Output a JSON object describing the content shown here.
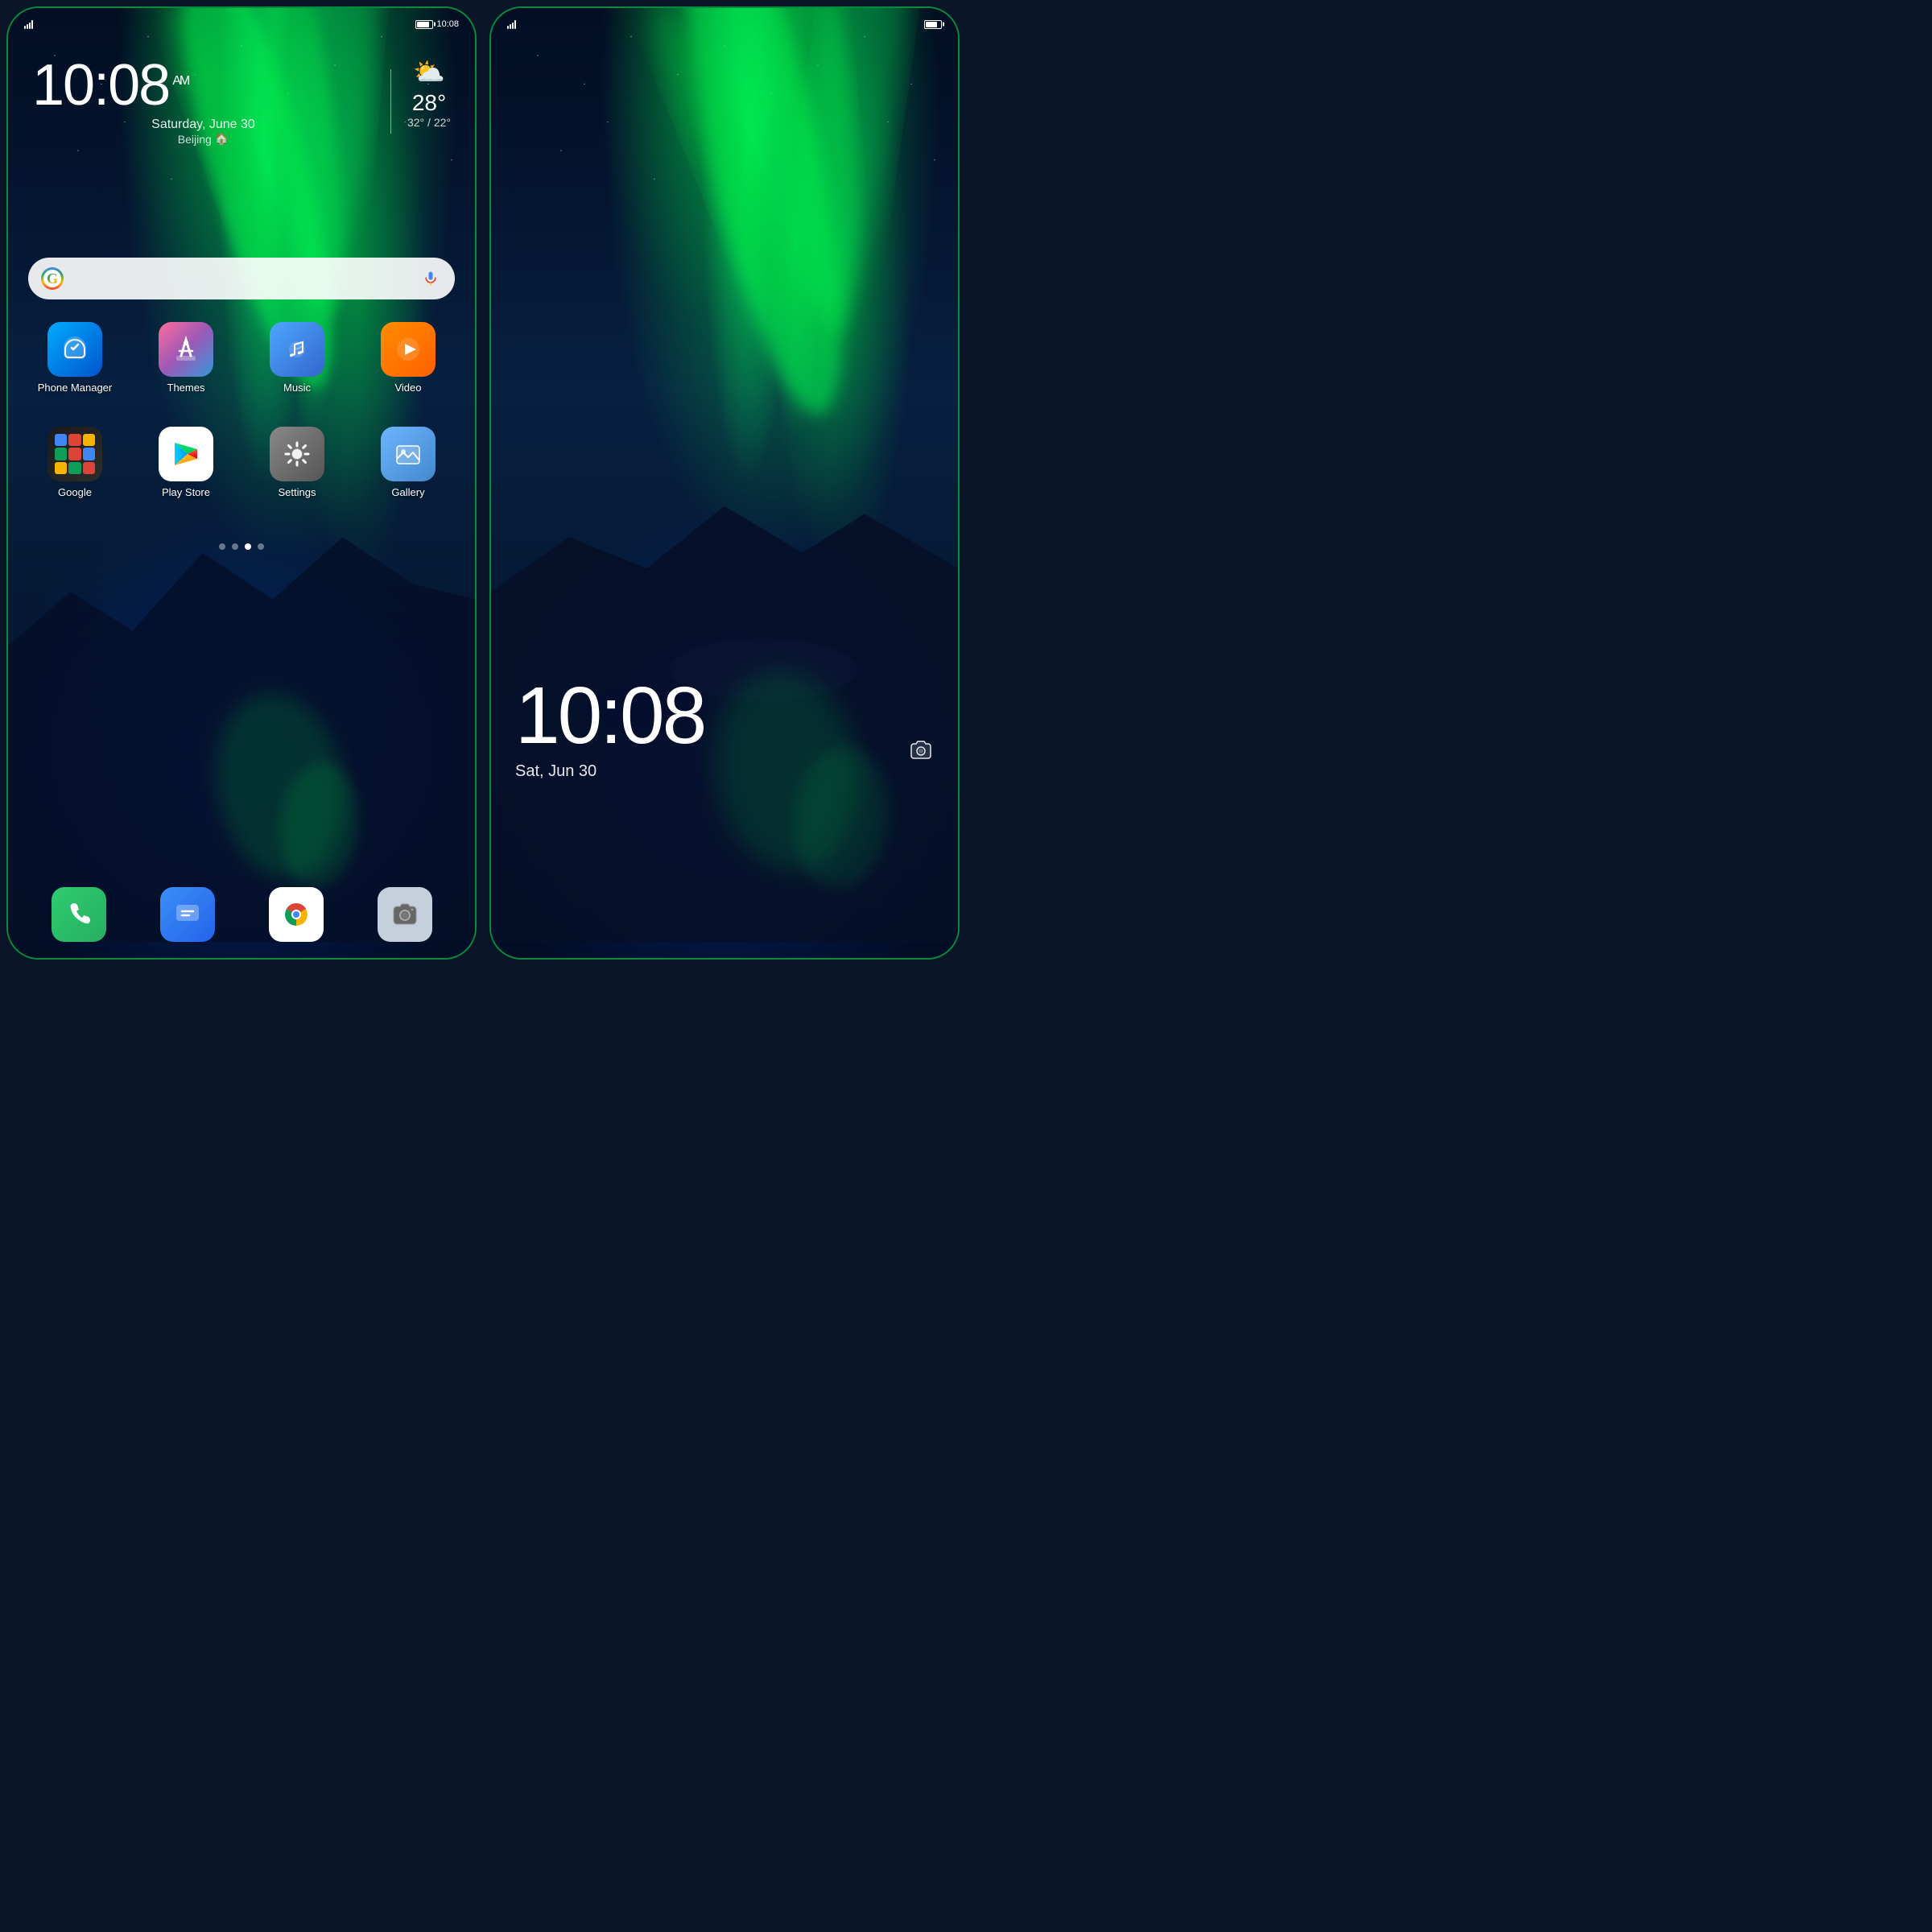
{
  "left_phone": {
    "status_bar": {
      "time": "10:08",
      "battery_label": "battery"
    },
    "clock": {
      "hour": "10:08",
      "ampm": "AM",
      "date": "Saturday, June 30",
      "location": "Beijing"
    },
    "weather": {
      "temp": "28°",
      "range": "32° / 22°",
      "icon": "⛅"
    },
    "search": {
      "placeholder": ""
    },
    "apps_row1": [
      {
        "name": "Phone Manager",
        "type": "phone-manager"
      },
      {
        "name": "Themes",
        "type": "themes"
      },
      {
        "name": "Music",
        "type": "music"
      },
      {
        "name": "Video",
        "type": "video"
      }
    ],
    "apps_row2": [
      {
        "name": "Google",
        "type": "google"
      },
      {
        "name": "Play Store",
        "type": "playstore"
      },
      {
        "name": "Settings",
        "type": "settings"
      },
      {
        "name": "Gallery",
        "type": "gallery"
      }
    ],
    "page_dots": [
      0,
      1,
      2,
      3
    ],
    "active_dot": 2,
    "dock": [
      {
        "name": "Phone",
        "type": "phone"
      },
      {
        "name": "Messages",
        "type": "messages"
      },
      {
        "name": "Chrome",
        "type": "chrome"
      },
      {
        "name": "Camera",
        "type": "camera"
      }
    ]
  },
  "right_phone": {
    "status_bar": {
      "time": "",
      "battery_label": "battery"
    },
    "lock_clock": {
      "time": "10:08",
      "date": "Sat, Jun 30"
    },
    "camera_btn": "📷"
  }
}
